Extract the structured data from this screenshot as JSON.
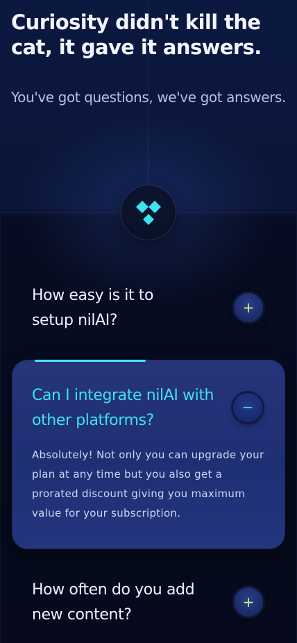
{
  "hero": {
    "title": "Curiosity didn't kill the cat, it gave it answers.",
    "subtitle": "You've got questions, we've got answers."
  },
  "logo": {
    "icon": "nilai-logo-icon",
    "color": "#3fe0f0"
  },
  "faq": [
    {
      "question": "How easy is it to setup nilAI?",
      "expanded": false,
      "toggle": "+"
    },
    {
      "question": "Can I integrate nilAI with other platforms?",
      "expanded": true,
      "toggle": "−",
      "answer": "Absolutely! Not only you can upgrade your plan at any time but you also get a prorated discount giving you maximum value for your subscription."
    },
    {
      "question": "How often do you add new content?",
      "expanded": false,
      "toggle": "+"
    }
  ],
  "colors": {
    "accent_cyan": "#3fe0f0",
    "accent_lime": "#d8f27a",
    "background": "#070b1f",
    "card": "#23357a"
  }
}
